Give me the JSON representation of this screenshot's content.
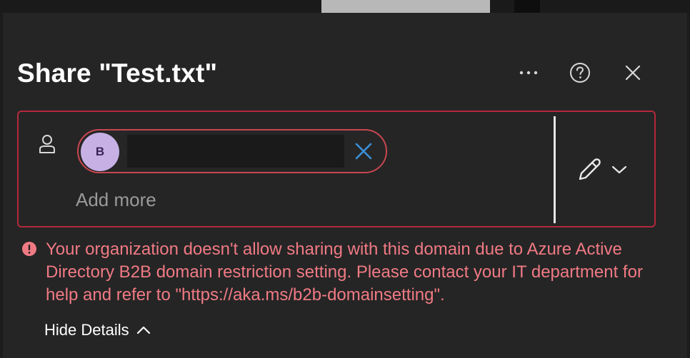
{
  "dialog": {
    "title": "Share \"Test.txt\"",
    "icons": {
      "more": "more-options-icon",
      "help": "help-icon",
      "close": "close-icon"
    }
  },
  "recipients": {
    "chips": [
      {
        "initial": "B",
        "name": ""
      }
    ],
    "add_more_placeholder": "Add more"
  },
  "error": {
    "message": "Your organization doesn't allow sharing with this domain due to Azure Active Directory B2B domain restriction setting. Please contact your IT department for help and refer to \"https://aka.ms/b2b-domainsetting\".",
    "color": "#f07a84"
  },
  "details_toggle": {
    "label": "Hide Details"
  },
  "colors": {
    "background": "#252525",
    "error_border": "#b4283c",
    "avatar_bg": "#c6b0e4",
    "remove_icon": "#3a8fd6"
  }
}
